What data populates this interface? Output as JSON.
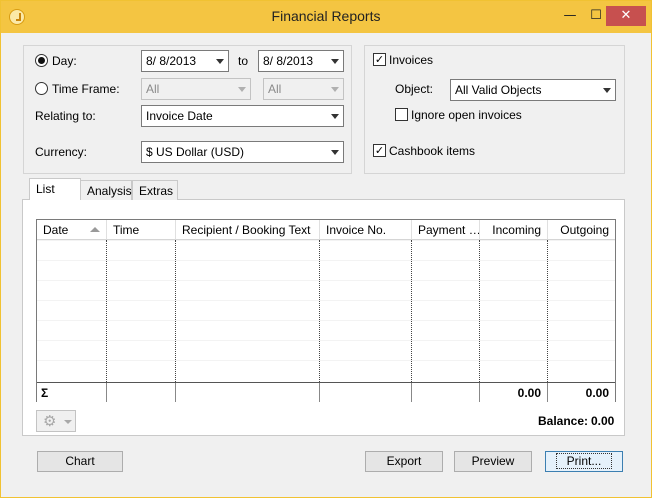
{
  "window": {
    "title": "Financial Reports",
    "minimize": "—",
    "maximize": "☐",
    "close": "✕"
  },
  "filter": {
    "day_label": "Day:",
    "date_from": "8/  8/2013",
    "to_label": "to",
    "date_to": "8/  8/2013",
    "timeframe_label": "Time Frame:",
    "timeframe_value": "All",
    "timeframe_sub_value": "All",
    "relating_label": "Relating to:",
    "relating_value": "Invoice Date",
    "currency_label": "Currency:",
    "currency_value": "$ US Dollar (USD)"
  },
  "options": {
    "invoices_label": "Invoices",
    "invoices_checked": true,
    "object_label": "Object:",
    "object_value": "All Valid Objects",
    "ignore_label": "Ignore open invoices",
    "ignore_checked": false,
    "cashbook_label": "Cashbook items",
    "cashbook_checked": true
  },
  "tabs": [
    {
      "label": "List",
      "active": true
    },
    {
      "label": "Analysis",
      "active": false
    },
    {
      "label": "Extras",
      "active": false
    }
  ],
  "table": {
    "columns": [
      "Date",
      "Time",
      "Recipient / Booking Text",
      "Invoice No.",
      "Payment …",
      "Incoming",
      "Outgoing"
    ],
    "sorted_column": "Date",
    "sum_label": "Σ",
    "sum_incoming": "0.00",
    "sum_outgoing": "0.00"
  },
  "balance": {
    "label": "Balance:",
    "value": "0.00"
  },
  "buttons": {
    "chart": "Chart",
    "export": "Export",
    "preview": "Preview",
    "print": "Print..."
  },
  "colors": {
    "titlebar": "#f4c542",
    "close": "#c7504f",
    "default_button_border": "#3c7fb1"
  }
}
